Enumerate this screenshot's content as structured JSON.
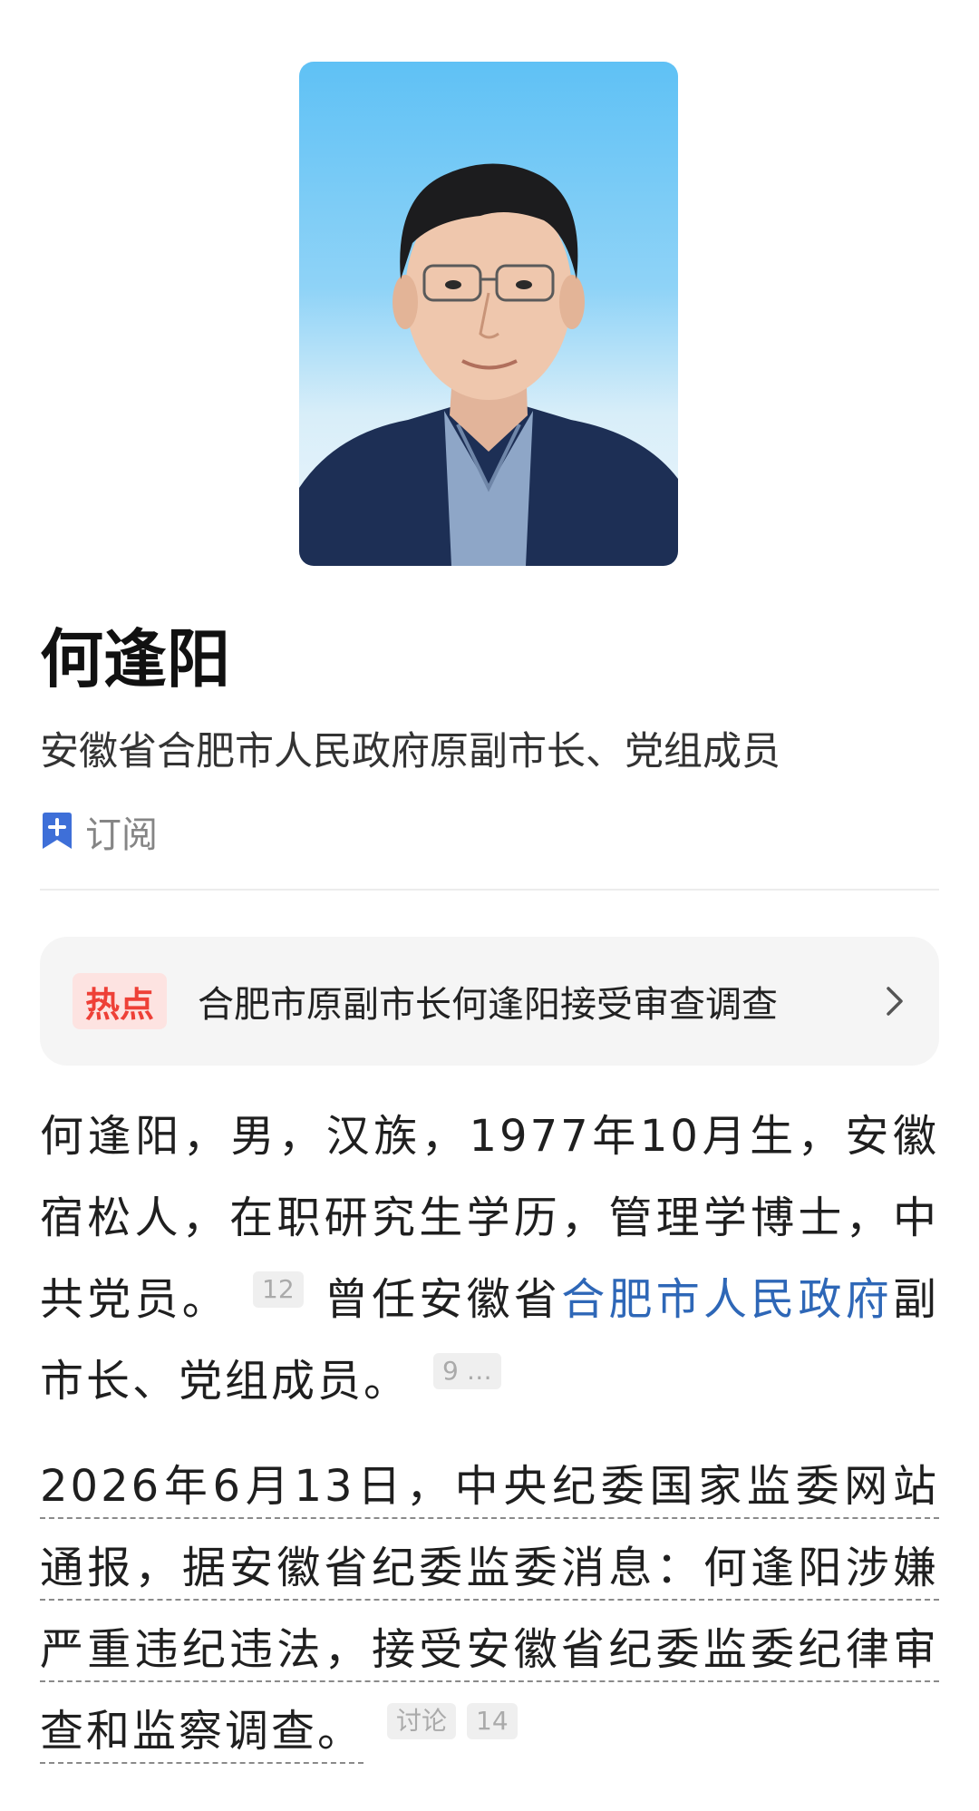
{
  "profile": {
    "name": "何逢阳",
    "subtitle": "安徽省合肥市人民政府原副市长、党组成员",
    "subscribe_label": "订阅"
  },
  "hot": {
    "badge": "热点",
    "text": "合肥市原副市长何逢阳接受审查调查"
  },
  "intro": {
    "text_a": "何逢阳，男，汉族，1977年10月生，安徽宿松人，在职研究生学历，管理学博士，中共党员。",
    "ref_a": "12",
    "text_b": "曾任安徽省",
    "link": "合肥市人民政府",
    "text_c": "副市长、党组成员。",
    "ref_b": "9 …"
  },
  "news": {
    "text": "2026年6月13日，中央纪委国家监委网站通报，据安徽省纪委监委消息：何逢阳涉嫌严重违纪违法，接受安徽省纪委监委纪律审查和监察调查。",
    "discuss_label": "讨论",
    "ref": "14"
  },
  "colors": {
    "link": "#2e67b7",
    "hot_badge_bg": "#fde3e1",
    "hot_badge_text": "#ee4037",
    "bookmark_icon": "#3e6fd8"
  },
  "icons": [
    "bookmark-plus-icon",
    "chevron-right-icon"
  ]
}
